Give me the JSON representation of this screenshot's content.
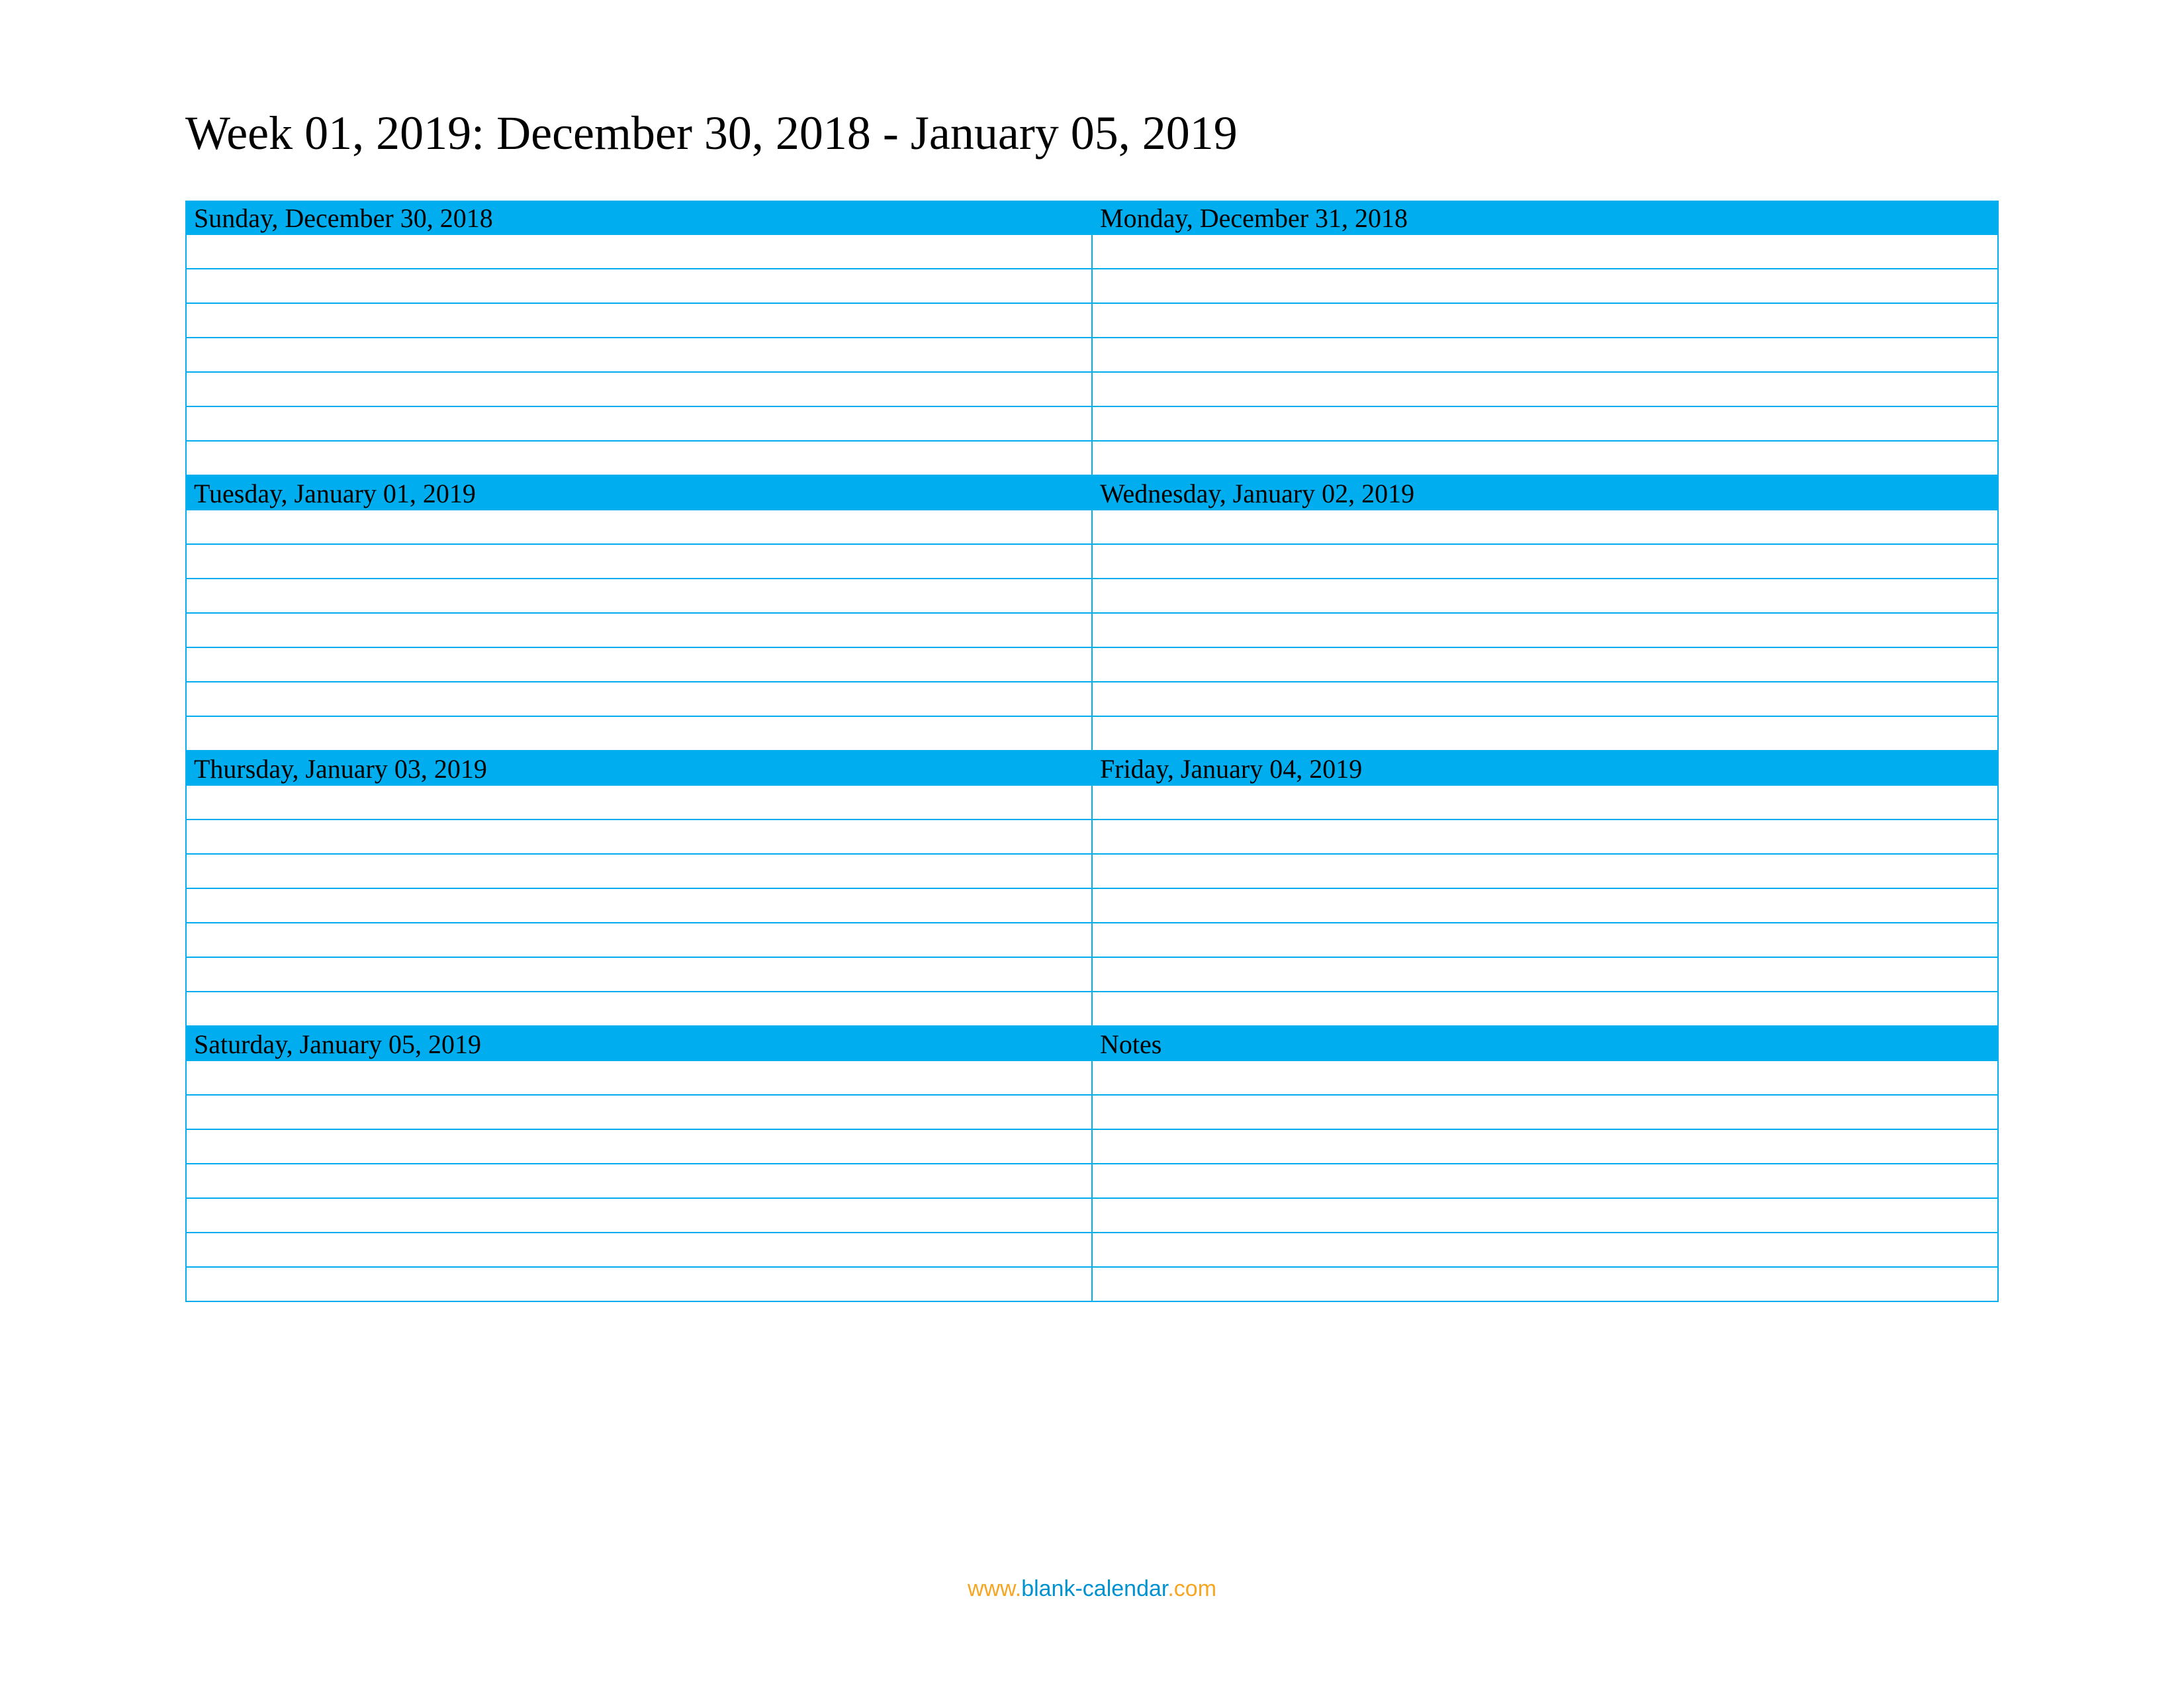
{
  "title": "Week 01, 2019: December 30, 2018 - January 05, 2019",
  "blocks": [
    {
      "header": "Sunday, December 30, 2018"
    },
    {
      "header": "Monday, December 31, 2018"
    },
    {
      "header": "Tuesday, January 01, 2019"
    },
    {
      "header": "Wednesday, January 02, 2019"
    },
    {
      "header": "Thursday, January 03, 2019"
    },
    {
      "header": "Friday, January 04, 2019"
    },
    {
      "header": "Saturday, January 05, 2019"
    },
    {
      "header": "Notes"
    }
  ],
  "rows_per_block": 7,
  "footer": {
    "www": "www.",
    "domain": "blank-calendar",
    "tld": ".com"
  },
  "colors": {
    "header_bg": "#00aeef",
    "border": "#00aeef",
    "footer_orange": "#f5a623",
    "footer_blue": "#0091d0"
  }
}
